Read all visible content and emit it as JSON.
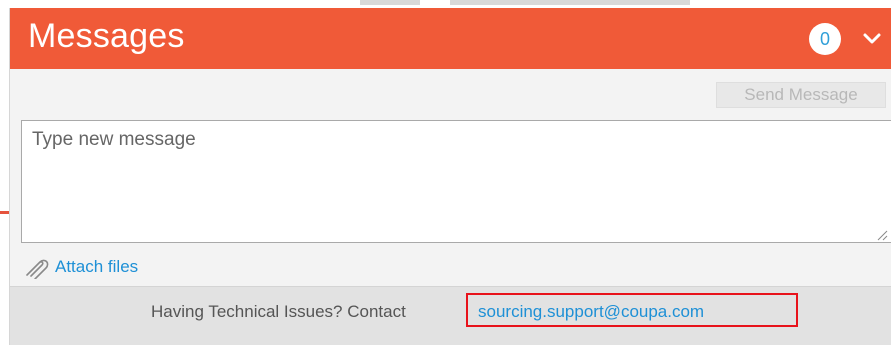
{
  "header": {
    "title": "Messages",
    "unread_count": "0",
    "collapse_icon": "chevron-down-icon",
    "accent_color": "#f05a38"
  },
  "composer": {
    "send_label": "Send Message",
    "placeholder": "Type new message",
    "value": ""
  },
  "attachments": {
    "icon": "paperclip-icon",
    "label": "Attach files"
  },
  "footer": {
    "text": "Having Technical Issues? Contact",
    "email": "sourcing.support@coupa.com"
  },
  "annotation": {
    "highlight_color": "#e8121b"
  }
}
